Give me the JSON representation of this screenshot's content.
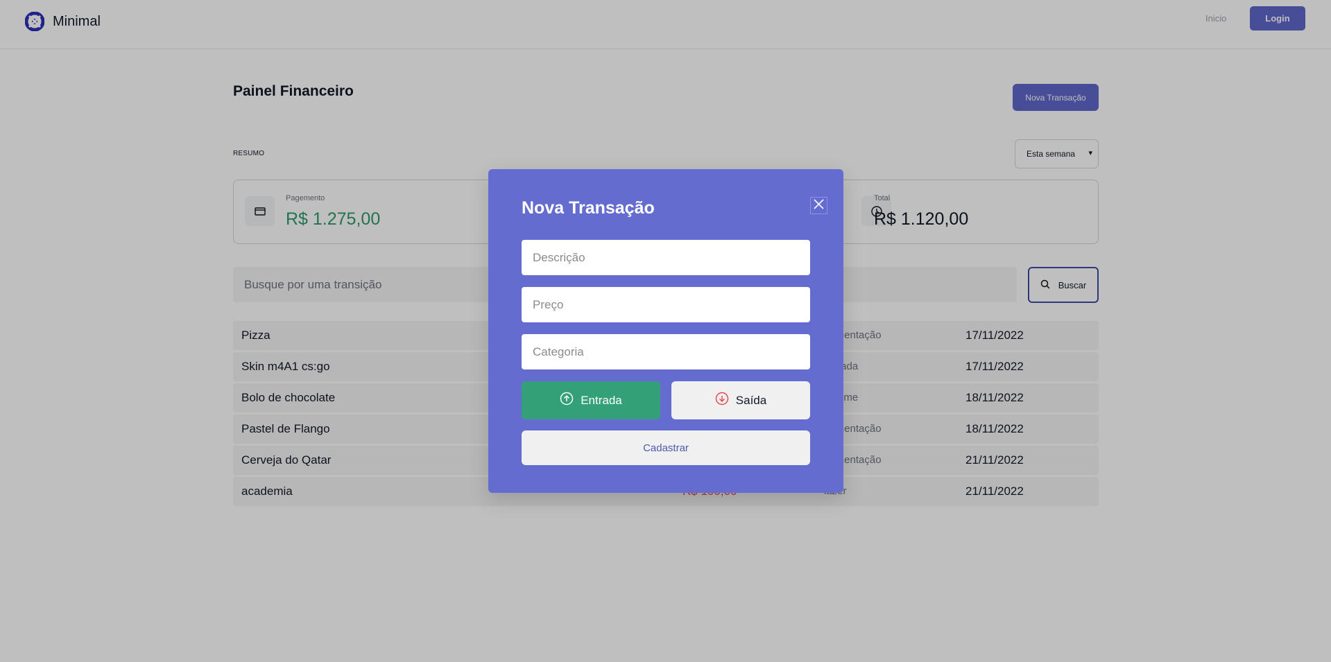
{
  "header": {
    "brand_name": "Minimal",
    "nav_inicio": "Inicio",
    "login_label": "Login"
  },
  "main": {
    "title": "Painel Financeiro",
    "new_transaction_label": "Nova Transação",
    "summary_heading": "RESUMO",
    "period_selected": "Esta semana",
    "cards": [
      {
        "label": "Pagemento",
        "value": "R$ 1.275,00",
        "icon": "wallet-icon",
        "color": "#2e9a6a"
      },
      {
        "label": "Total",
        "value": "R$ 1.120,00",
        "icon": "clock-icon",
        "color": "#111827"
      }
    ],
    "search_placeholder": "Busque por uma transição",
    "search_button_label": "Buscar",
    "transactions": [
      {
        "description": "Pizza",
        "category": "Alimentação",
        "date": "17/11/2022"
      },
      {
        "description": "Skin m4A1 cs:go",
        "category": "Jogada",
        "date": "17/11/2022"
      },
      {
        "description": "Bolo de chocolate",
        "category": "Income",
        "date": "18/11/2022"
      },
      {
        "description": "Pastel de Flango",
        "category": "Alimentação",
        "date": "18/11/2022"
      },
      {
        "description": "Cerveja do Qatar",
        "category": "Alimentação",
        "date": "21/11/2022"
      },
      {
        "description": "academia",
        "price": "R$ 100,00",
        "category": "lazer",
        "date": "21/11/2022"
      }
    ]
  },
  "modal": {
    "title": "Nova Transação",
    "description_placeholder": "Descrição",
    "price_placeholder": "Preço",
    "category_placeholder": "Categoria",
    "entrada_label": "Entrada",
    "saida_label": "Saída",
    "submit_label": "Cadastrar"
  },
  "colors": {
    "primary": "#5f67c9",
    "modal_background": "#646dcf",
    "income_green": "#33a077",
    "outcome_red": "#e5484d"
  }
}
